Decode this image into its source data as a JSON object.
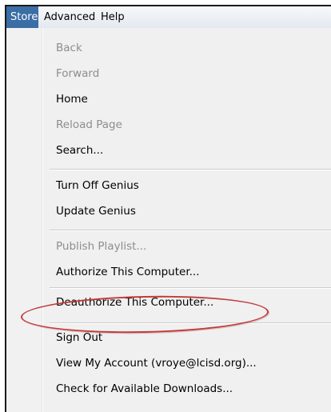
{
  "menubar": {
    "items": [
      {
        "label": "Store"
      },
      {
        "label": "Advanced"
      },
      {
        "label": "Help"
      }
    ]
  },
  "store_menu": {
    "items": [
      {
        "label": "Back",
        "enabled": false
      },
      {
        "label": "Forward",
        "enabled": false
      },
      {
        "label": "Home",
        "enabled": true
      },
      {
        "label": "Reload Page",
        "enabled": false
      },
      {
        "label": "Search...",
        "enabled": true
      },
      {
        "label": "Turn Off Genius",
        "enabled": true
      },
      {
        "label": "Update Genius",
        "enabled": true
      },
      {
        "label": "Publish Playlist...",
        "enabled": false
      },
      {
        "label": "Authorize This Computer...",
        "enabled": true
      },
      {
        "label": "Deauthorize This Computer...",
        "enabled": true
      },
      {
        "label": "Sign Out",
        "enabled": true
      },
      {
        "label": "View My Account (vroye@lcisd.org)...",
        "enabled": true
      },
      {
        "label": "Check for Available Downloads...",
        "enabled": true
      }
    ]
  },
  "colors": {
    "active_menu": "#3a6ea5",
    "highlight_circle": "#c23b3b",
    "disabled_text": "#8d8d8d"
  }
}
